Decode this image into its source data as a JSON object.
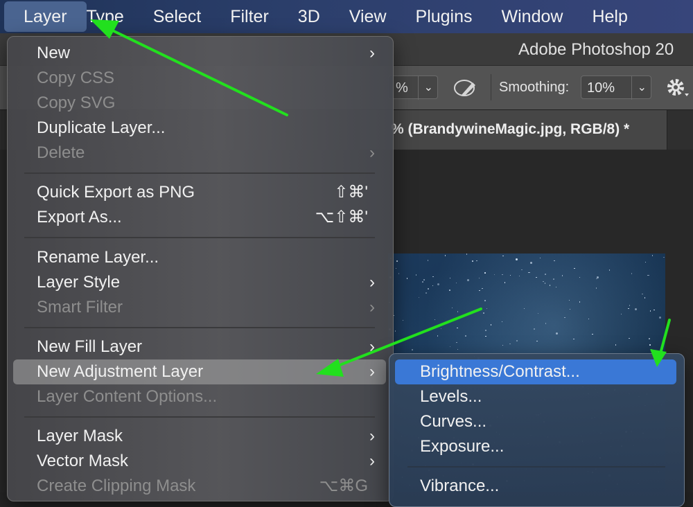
{
  "menubar": {
    "items": [
      "Layer",
      "Type",
      "Select",
      "Filter",
      "3D",
      "View",
      "Plugins",
      "Window",
      "Help"
    ]
  },
  "window": {
    "title": "Adobe Photoshop 20"
  },
  "options_bar": {
    "percent_value": "%",
    "smoothing_label": "Smoothing:",
    "smoothing_value": "10%"
  },
  "document_tab": {
    "title": "% (BrandywineMagic.jpg, RGB/8) *"
  },
  "layer_menu": {
    "new": "New",
    "copy_css": "Copy CSS",
    "copy_svg": "Copy SVG",
    "duplicate_layer": "Duplicate Layer...",
    "delete": "Delete",
    "quick_export": "Quick Export as PNG",
    "quick_export_shortcut": "⇧⌘'",
    "export_as": "Export As...",
    "export_as_shortcut": "⌥⇧⌘'",
    "rename_layer": "Rename Layer...",
    "layer_style": "Layer Style",
    "smart_filter": "Smart Filter",
    "new_fill_layer": "New Fill Layer",
    "new_adjustment_layer": "New Adjustment Layer",
    "layer_content_options": "Layer Content Options...",
    "layer_mask": "Layer Mask",
    "vector_mask": "Vector Mask",
    "create_clipping_mask": "Create Clipping Mask",
    "create_clipping_mask_shortcut": "⌥⌘G",
    "arrow_glyph": "›"
  },
  "adjustment_submenu": {
    "items": [
      "Brightness/Contrast...",
      "Levels...",
      "Curves...",
      "Exposure...",
      "Vibrance..."
    ]
  },
  "colors": {
    "selection_blue": "#3a78d6",
    "annotation_arrow": "#22e01e",
    "menubar_active": "#4a6490"
  },
  "icons": {
    "chevron": "chevron-down-icon",
    "brush": "pressure-brush-icon",
    "settings": "gear-icon"
  }
}
